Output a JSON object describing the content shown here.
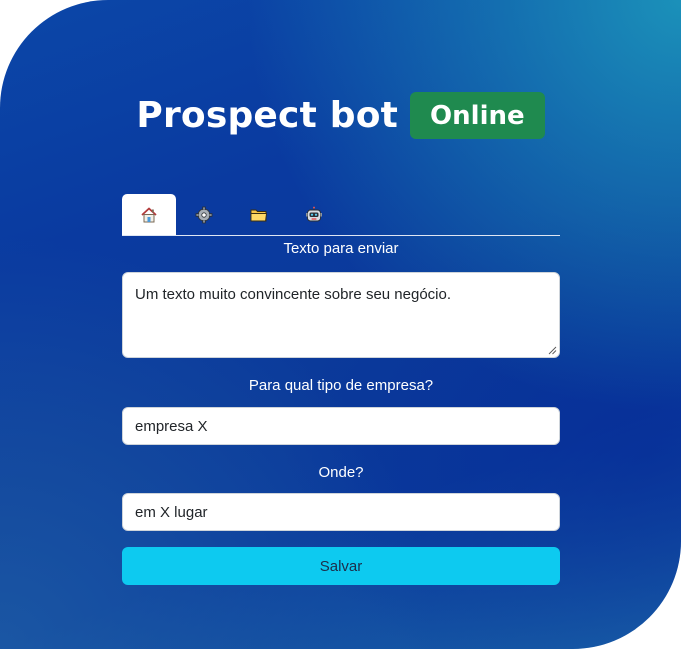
{
  "header": {
    "title": "Prospect bot",
    "status_badge": "Online",
    "status_color": "#1f8a4f"
  },
  "tabs": [
    {
      "icon": "house-icon",
      "active": true
    },
    {
      "icon": "gear-icon",
      "active": false
    },
    {
      "icon": "folder-icon",
      "active": false
    },
    {
      "icon": "robot-icon",
      "active": false
    }
  ],
  "form": {
    "message_label": "Texto para enviar",
    "message_value": "Um texto muito convincente sobre seu negócio.",
    "company_type_label": "Para qual tipo de empresa?",
    "company_type_value": "empresa X",
    "location_label": "Onde?",
    "location_value": "em X lugar",
    "save_label": "Salvar"
  },
  "colors": {
    "accent_button": "#0dcaf0",
    "card_gradient_start": "#0b47a8",
    "card_gradient_end": "#1a63a8"
  }
}
